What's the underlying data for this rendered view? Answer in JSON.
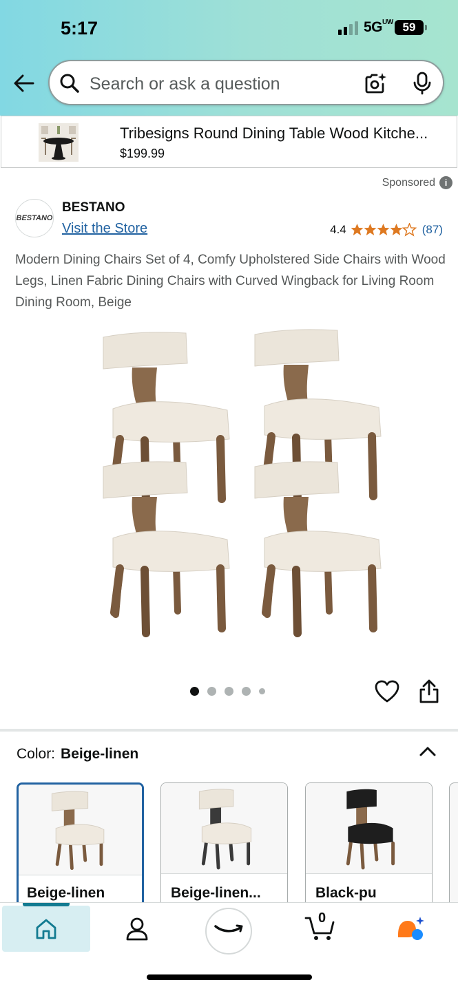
{
  "status_bar": {
    "time": "5:17",
    "network": "5G",
    "network_suffix": "UW",
    "battery": "59"
  },
  "search": {
    "placeholder": "Search or ask a question"
  },
  "sponsored_banner": {
    "title": "Tribesigns Round Dining Table Wood Kitche...",
    "price": "$199.99"
  },
  "sponsored_label": "Sponsored",
  "brand": {
    "logo_text": "BESTANO",
    "name": "BESTANO",
    "store_link": "Visit the Store"
  },
  "rating": {
    "value": "4.4",
    "stars": 4.4,
    "count": "(87)"
  },
  "product": {
    "title": "Modern Dining Chairs Set of 4, Comfy Upholstered Side Chairs with Wood Legs, Linen Fabric Dining Chairs with Curved Wingback for Living Room Dining Room, Beige",
    "image_count": 5,
    "active_image_index": 0
  },
  "color": {
    "label": "Color:",
    "selected": "Beige-linen",
    "options": [
      {
        "label": "Beige-linen",
        "frame": "#7a5a3e",
        "seat": "#ece6dc"
      },
      {
        "label": "Beige-linen...",
        "frame": "#3a3a3a",
        "seat": "#ece6dc"
      },
      {
        "label": "Black-pu",
        "frame": "#7a5a3e",
        "seat": "#1e1e1e"
      }
    ]
  },
  "cart": {
    "count": "0"
  },
  "colors": {
    "link": "#2162a1",
    "star": "#de7921",
    "accent": "#137b91",
    "header_start": "#82d8e3",
    "header_end": "#a6e4cf"
  }
}
